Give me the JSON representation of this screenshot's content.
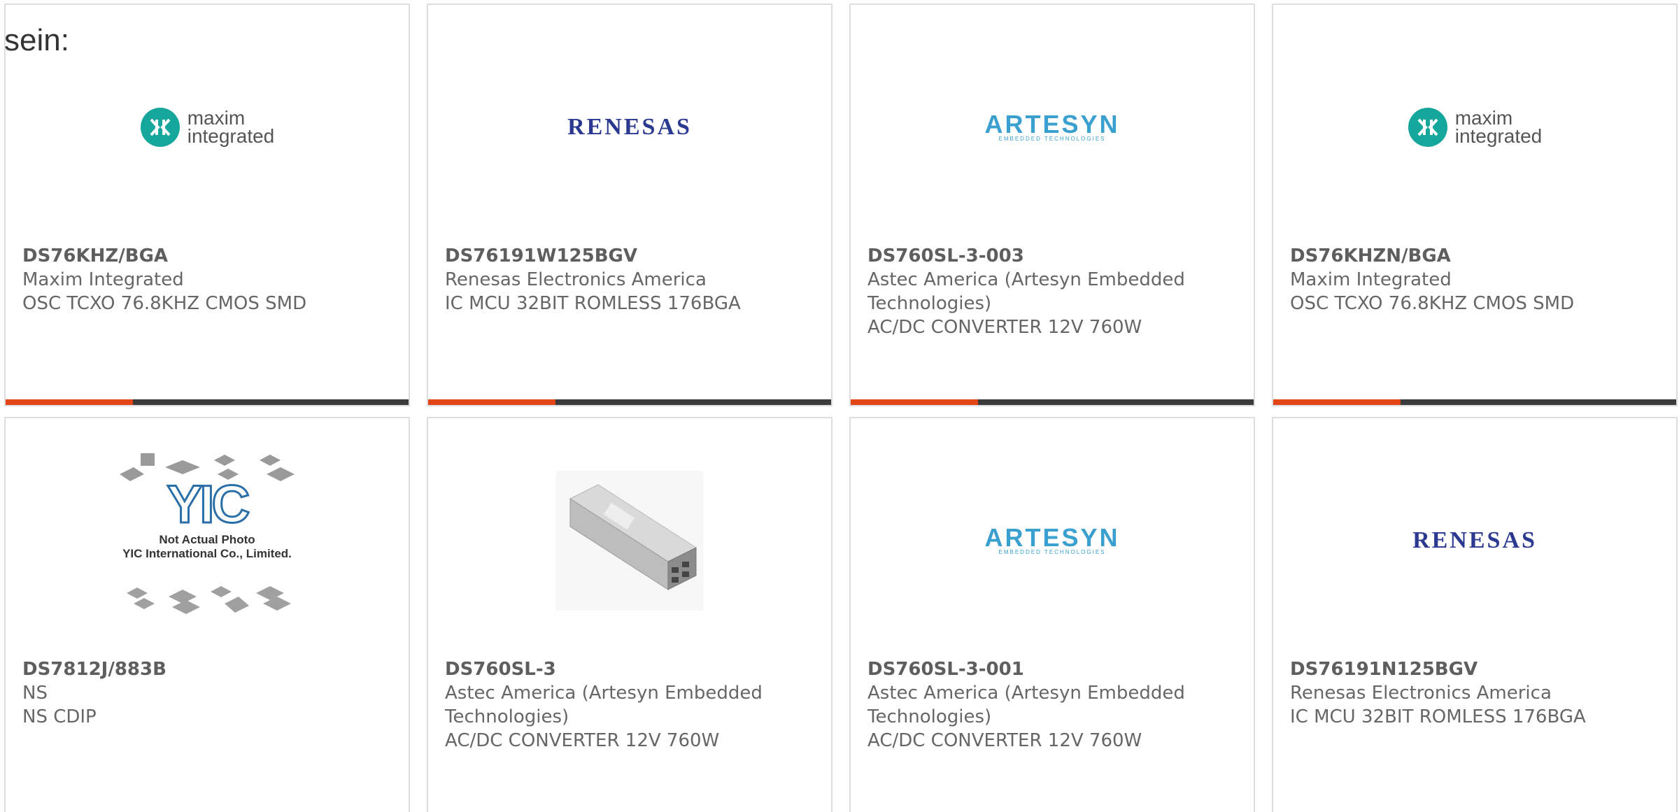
{
  "intro_text": "sein:",
  "colors": {
    "accent": "#e34517",
    "bar": "#3b3b3b",
    "maxim_teal": "#15a79b",
    "renesas_blue": "#2b3990",
    "artesyn_blue": "#3aa0cf"
  },
  "cards": [
    {
      "part_number": "DS76KHZ/BGA",
      "manufacturer": "Maxim Integrated",
      "description": "OSC TCXO 76.8KHZ CMOS SMD",
      "logo": "maxim-integrated-logo",
      "logo_lines": [
        "maxim",
        "integrated"
      ]
    },
    {
      "part_number": "DS76191W125BGV",
      "manufacturer": "Renesas Electronics America",
      "description": "IC MCU 32BIT ROMLESS 176BGA",
      "logo": "renesas-logo",
      "logo_lines": [
        "RENESAS"
      ]
    },
    {
      "part_number": "DS760SL-3-003",
      "manufacturer": "Astec America (Artesyn Embedded Technologies)",
      "description": "AC/DC CONVERTER 12V 760W",
      "logo": "artesyn-logo",
      "logo_lines": [
        "ARTESYN",
        "EMBEDDED TECHNOLOGIES"
      ]
    },
    {
      "part_number": "DS76KHZN/BGA",
      "manufacturer": "Maxim Integrated",
      "description": "OSC TCXO 76.8KHZ CMOS SMD",
      "logo": "maxim-integrated-logo",
      "logo_lines": [
        "maxim",
        "integrated"
      ]
    },
    {
      "part_number": "DS7812J/883B",
      "manufacturer": "NS",
      "description": "NS CDIP",
      "logo": "yic-placeholder-image",
      "logo_lines": [
        "YIC",
        "Not Actual Photo",
        "YIC International Co., Limited."
      ]
    },
    {
      "part_number": "DS760SL-3",
      "manufacturer": "Astec America (Artesyn Embedded Technologies)",
      "description": "AC/DC CONVERTER 12V 760W",
      "logo": "power-supply-photo",
      "logo_lines": []
    },
    {
      "part_number": "DS760SL-3-001",
      "manufacturer": "Astec America (Artesyn Embedded Technologies)",
      "description": "AC/DC CONVERTER 12V 760W",
      "logo": "artesyn-logo",
      "logo_lines": [
        "ARTESYN",
        "EMBEDDED TECHNOLOGIES"
      ]
    },
    {
      "part_number": "DS76191N125BGV",
      "manufacturer": "Renesas Electronics America",
      "description": "IC MCU 32BIT ROMLESS 176BGA",
      "logo": "renesas-logo",
      "logo_lines": [
        "RENESAS"
      ]
    }
  ]
}
